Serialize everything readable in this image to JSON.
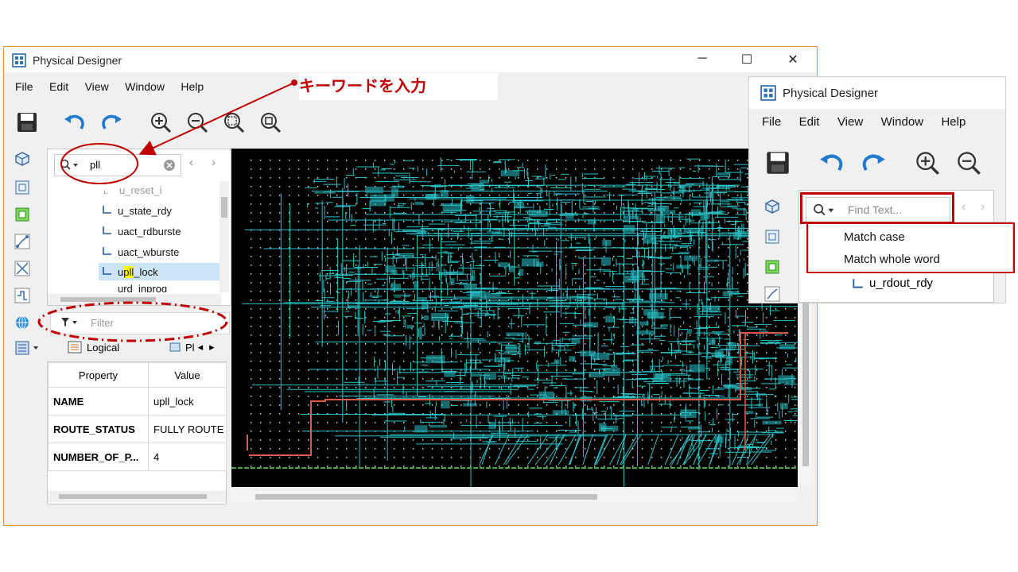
{
  "main_window": {
    "title": "Physical Designer",
    "menu": [
      "File",
      "Edit",
      "View",
      "Window",
      "Help"
    ],
    "search_value": "pll",
    "tree_items": [
      "u_reset_i",
      "u_state_rdy",
      "uact_rdburste",
      "uact_wburste",
      "upll_lock",
      "urd_inprog"
    ],
    "selected_item": {
      "pre": "u",
      "hl": "pll",
      "post": "_lock"
    },
    "filter_placeholder": "Filter",
    "tabs": {
      "logical": "Logical",
      "physical": "Pl"
    },
    "properties": {
      "header": {
        "property": "Property",
        "value": "Value"
      },
      "rows": [
        {
          "name": "NAME",
          "value": "upll_lock"
        },
        {
          "name": "ROUTE_STATUS",
          "value": "FULLY ROUTE"
        },
        {
          "name": "NUMBER_OF_P...",
          "value": "4"
        }
      ]
    }
  },
  "annotation": {
    "text": "キーワードを入力",
    "color": "#c00000"
  },
  "inset_window": {
    "title": "Physical Designer",
    "menu": [
      "File",
      "Edit",
      "View",
      "Window",
      "Help"
    ],
    "search_placeholder": "Find Text...",
    "options": [
      "Match case",
      "Match whole word"
    ],
    "tree_item": "u_rdout_rdy"
  },
  "colors": {
    "route": "#2ac3c8",
    "highlight": "#e05a4a",
    "canvas": "#000000",
    "accent": "#c00000"
  },
  "icons": [
    "save-icon",
    "undo-icon",
    "redo-icon",
    "zoom-in-icon",
    "zoom-out-icon",
    "zoom-fit-icon",
    "zoom-select-icon",
    "search-icon",
    "filter-icon",
    "clear-icon"
  ]
}
